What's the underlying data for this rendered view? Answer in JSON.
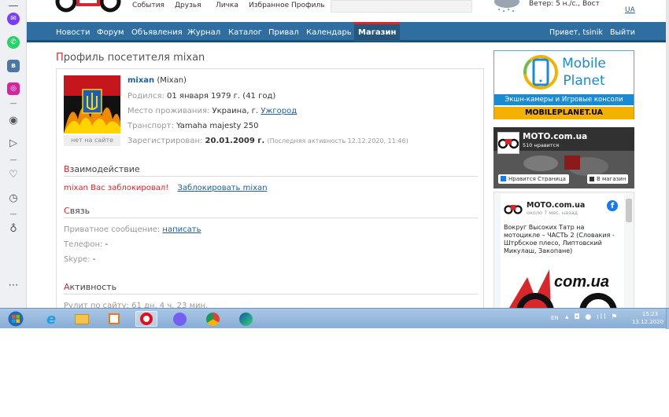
{
  "top": {
    "links": [
      "События",
      "Друзья",
      "Личка",
      "Избранное",
      "Профиль"
    ],
    "weather": "Ветер: 5 н./с., Вост",
    "lang": "UA"
  },
  "nav": {
    "items": [
      "Новости",
      "Форум",
      "Объявления",
      "Журнал",
      "Каталог",
      "Привал",
      "Календарь"
    ],
    "active": "Магазин",
    "greeting": "Привет, tsinik",
    "logout": "Выйти"
  },
  "profile": {
    "title_first": "П",
    "title_rest": "рофиль посетителя mixan",
    "username": "mixan",
    "realname": "(Mixan)",
    "born_label": "Родился:",
    "born_value": "01 января 1979 г. (41 год)",
    "place_label": "Место проживания:",
    "place_value": "Украина, г.",
    "place_city": "Ужгород",
    "transport_label": "Транспорт:",
    "transport_value": "Yamaha majesty 250",
    "registered_label": "Зарегистрирован:",
    "registered_value": "20.01.2009 г.",
    "last_activity": "(Последняя активность 12.12.2020, 11:46)",
    "status": "нет на сайте"
  },
  "interaction": {
    "title_first": "В",
    "title_rest": "заимодействие",
    "blocked_msg": "mixan Вас заблокировал!",
    "block_link": "Заблокировать mixan"
  },
  "contact": {
    "title_first": "С",
    "title_rest": "вязь",
    "private_label": "Приватное сообщение:",
    "private_link": "написать",
    "phone_label": "Телефон:",
    "phone_value": "-",
    "skype_label": "Skype:",
    "skype_value": "-"
  },
  "activity": {
    "title_first": "А",
    "title_rest": "ктивность",
    "row": "Рулит по сайту: 61 дн. 4 ч. 23 мин."
  },
  "ads": {
    "mobile_brand_1": "Mobile",
    "mobile_brand_2": "Planet",
    "mobile_strip": "Экшн-камеры и Игровые консоли",
    "mobile_url": "MOBILEPLANET.UA"
  },
  "fb": {
    "page_name": "MOTO.com.ua",
    "likes": "510 нравится",
    "like_btn": "Нравится Страница",
    "shop_btn": "В магазин",
    "post_name": "MOTO.com.ua",
    "post_time": "около 7 мес. назад",
    "post_text": "Вокруг Высоких Татр на мотоцикле – ЧАСТЬ 2 (Словакия - Штрбское плесо, Липтовский Микулаш, Закопане)",
    "post_image_text": "com.ua"
  },
  "taskbar": {
    "lang": "EN",
    "time": "15:23",
    "date": "13.12.2020"
  },
  "colors": {
    "nav_bg": "#2f6ea1",
    "accent_red": "#d9262b",
    "link_blue": "#1f5e99"
  }
}
